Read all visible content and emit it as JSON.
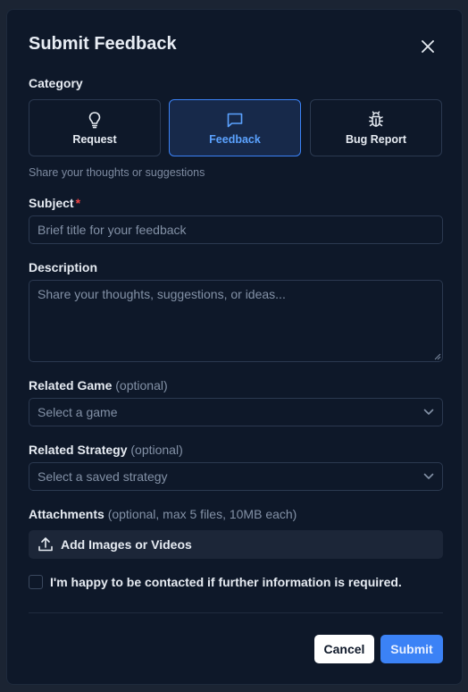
{
  "dialog": {
    "title": "Submit Feedback"
  },
  "category": {
    "label": "Category",
    "options": [
      {
        "label": "Request",
        "icon": "lightbulb-icon"
      },
      {
        "label": "Feedback",
        "icon": "message-square-icon",
        "selected": true
      },
      {
        "label": "Bug Report",
        "icon": "bug-icon"
      }
    ],
    "hint": "Share your thoughts or suggestions"
  },
  "subject": {
    "label": "Subject",
    "required_mark": "*",
    "placeholder": "Brief title for your feedback"
  },
  "description": {
    "label": "Description",
    "placeholder": "Share your thoughts, suggestions, or ideas..."
  },
  "related_game": {
    "label": "Related Game",
    "optional": "(optional)",
    "placeholder": "Select a game"
  },
  "related_strategy": {
    "label": "Related Strategy",
    "optional": "(optional)",
    "placeholder": "Select a saved strategy"
  },
  "attachments": {
    "label": "Attachments",
    "optional": "(optional, max 5 files, 10MB each)",
    "button_label": "Add Images or Videos"
  },
  "contact": {
    "label": "I'm happy to be contacted if further information is required.",
    "checked": false
  },
  "actions": {
    "cancel": "Cancel",
    "submit": "Submit"
  },
  "colors": {
    "accent": "#3b82f6",
    "background": "#0e1829",
    "required": "#ef4444"
  }
}
